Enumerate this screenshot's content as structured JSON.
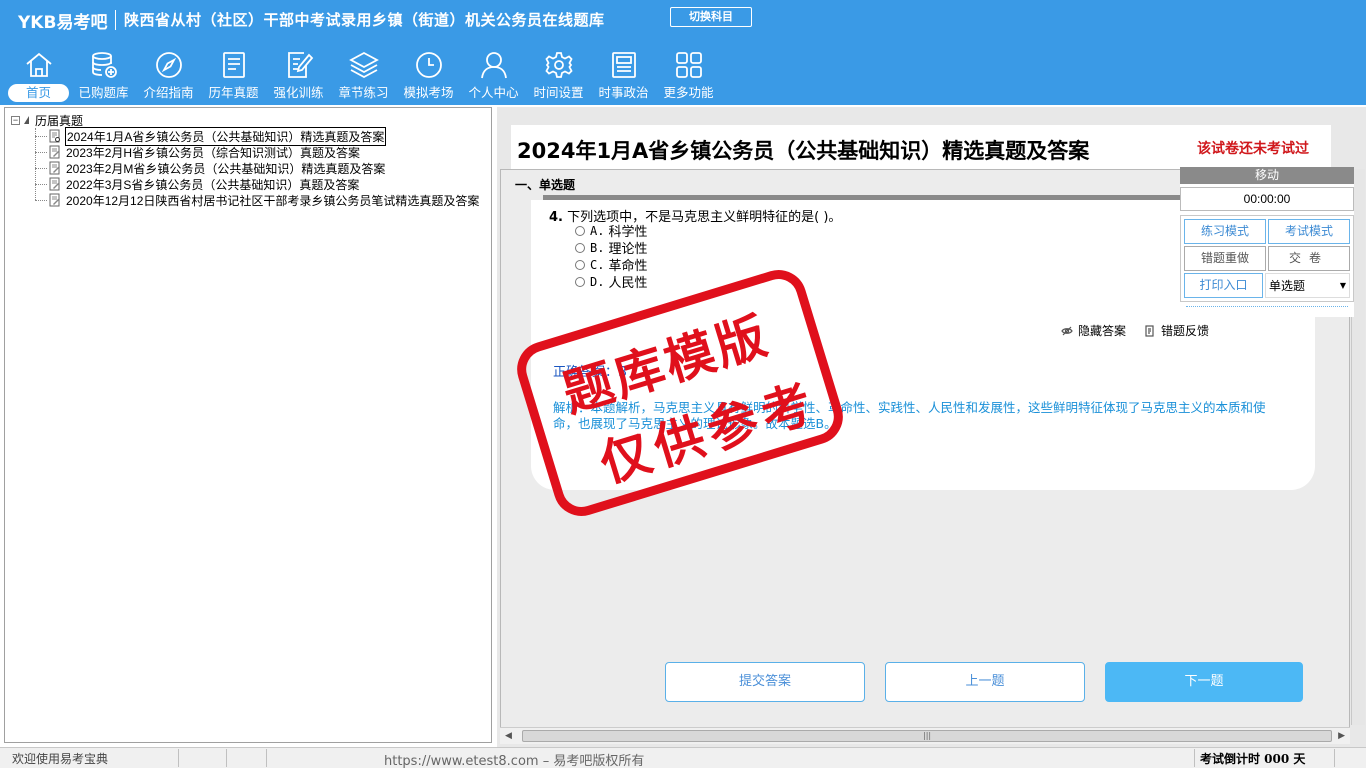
{
  "header": {
    "brand": "YKB易考吧",
    "title": "陕西省从村（社区）干部中考试录用乡镇（街道）机关公务员在线题库",
    "switch_label": "切换科目"
  },
  "nav": [
    {
      "label": "首页",
      "icon": "home-icon"
    },
    {
      "label": "已购题库",
      "icon": "database-add-icon"
    },
    {
      "label": "介绍指南",
      "icon": "compass-icon"
    },
    {
      "label": "历年真题",
      "icon": "list-doc-icon"
    },
    {
      "label": "强化训练",
      "icon": "edit-doc-icon"
    },
    {
      "label": "章节练习",
      "icon": "layers-icon"
    },
    {
      "label": "模拟考场",
      "icon": "clock-icon"
    },
    {
      "label": "个人中心",
      "icon": "user-icon"
    },
    {
      "label": "时间设置",
      "icon": "gear-icon"
    },
    {
      "label": "时事政治",
      "icon": "newspaper-icon"
    },
    {
      "label": "更多功能",
      "icon": "grid-icon"
    }
  ],
  "tree": {
    "root": "历届真题",
    "items": [
      "2024年1月A省乡镇公务员（公共基础知识）精选真题及答案",
      "2023年2月H省乡镇公务员（综合知识测试）真题及答案",
      "2023年2月M省乡镇公务员（公共基础知识）精选真题及答案",
      "2022年3月S省乡镇公务员（公共基础知识）真题及答案",
      "2020年12月12日陕西省村居书记社区干部考录乡镇公务员笔试精选真题及答案"
    ]
  },
  "paper": {
    "title": "2024年1月A省乡镇公务员（公共基础知识）精选真题及答案",
    "status": "该试卷还未考试过"
  },
  "question": {
    "section": "一、单选题",
    "number": "4.",
    "text": "下列选项中，不是马克思主义鲜明特征的是(  )。",
    "options": [
      {
        "letter": "A.",
        "text": "科学性"
      },
      {
        "letter": "B.",
        "text": "理论性"
      },
      {
        "letter": "C.",
        "text": "革命性"
      },
      {
        "letter": "D.",
        "text": "人民性"
      }
    ],
    "hide_answer": "隐藏答案",
    "report_error": "错题反馈",
    "answer_label": "正确答案：B",
    "analysis": "解析：本题解析，马克思主义具有鲜明的科学性、革命性、实践性、人民性和发展性，这些鲜明特征体现了马克思主义的本质和使命，也展现了马克思主义的理论形象。故本题选B。"
  },
  "buttons": {
    "submit": "提交答案",
    "prev": "上一题",
    "next": "下一题"
  },
  "control": {
    "move": "移动",
    "timer": "00:00:00",
    "practice_mode": "练习模式",
    "exam_mode": "考试模式",
    "redo_wrong": "错题重做",
    "submit_paper": "交卷",
    "print": "打印入口",
    "type_select": "单选题"
  },
  "stamp": {
    "line1": "题库模版",
    "line2": "仅供参考"
  },
  "status": {
    "welcome": "欢迎使用易考宝典",
    "copyright": "https://www.etest8.com – 易考吧版权所有",
    "countdown": "考试倒计时 000 天"
  },
  "colors": {
    "header_bg": "#3a9ae6",
    "accent_red": "#d0181c",
    "stamp_red": "#e0101c",
    "next_button": "#4cb8f5",
    "analysis_text": "#1a90d8"
  }
}
